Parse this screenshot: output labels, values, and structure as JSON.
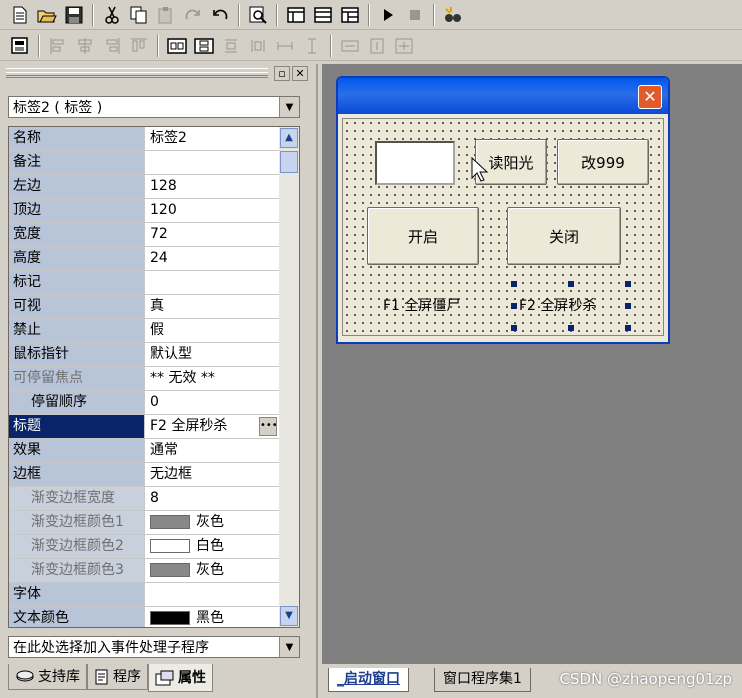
{
  "toolbar1": [
    "new-file-icon",
    "open-folder-icon",
    "save-icon",
    "cut-icon",
    "copy-icon",
    "paste-icon",
    "redo-icon",
    "undo-icon",
    "find-icon",
    "layout-a-icon",
    "layout-b-icon",
    "layout-c-icon",
    "run-icon",
    "stop-icon",
    "debug-icon"
  ],
  "toolbar2": [
    "align-grid-icon",
    "align-left-icon",
    "align-center-icon",
    "align-right-icon",
    "align-top-icon",
    "space-h-icon",
    "space-v-icon",
    "center-h-icon",
    "center-v-icon",
    "size-w-icon",
    "size-h-icon",
    "size-both-icon",
    "expand-h-icon",
    "expand-v-icon",
    "expand-both-icon"
  ],
  "object_selector": "标签2 ( 标签 )",
  "event_selector": "在此处选择加入事件处理子程序",
  "properties": [
    {
      "name": "名称",
      "value": "标签2"
    },
    {
      "name": "备注",
      "value": ""
    },
    {
      "name": "左边",
      "value": "128"
    },
    {
      "name": "顶边",
      "value": "120"
    },
    {
      "name": "宽度",
      "value": "72"
    },
    {
      "name": "高度",
      "value": "24"
    },
    {
      "name": "标记",
      "value": ""
    },
    {
      "name": "可视",
      "value": "真"
    },
    {
      "name": "禁止",
      "value": "假"
    },
    {
      "name": "鼠标指针",
      "value": "默认型"
    },
    {
      "name": "可停留焦点",
      "value": "** 无效 **"
    },
    {
      "name": "停留顺序",
      "value": "0"
    },
    {
      "name": "标题",
      "value": "F2 全屏秒杀"
    },
    {
      "name": "效果",
      "value": "通常"
    },
    {
      "name": "边框",
      "value": "无边框"
    },
    {
      "name": "渐变边框宽度",
      "value": "8"
    },
    {
      "name": "渐变边框颜色1",
      "value": "灰色",
      "swatch": "#888888"
    },
    {
      "name": "渐变边框颜色2",
      "value": "白色",
      "swatch": "#ffffff"
    },
    {
      "name": "渐变边框颜色3",
      "value": "灰色",
      "swatch": "#888888"
    },
    {
      "name": "字体",
      "value": ""
    },
    {
      "name": "文本颜色",
      "value": "黑色",
      "swatch": "#000000"
    }
  ],
  "left_tabs": [
    {
      "label": "支持库"
    },
    {
      "label": "程序"
    },
    {
      "label": "属性"
    }
  ],
  "form": {
    "btn_read": "读阳光",
    "btn_change": "改999",
    "btn_open": "开启",
    "btn_close": "关闭",
    "label1": "F1 全屏僵尸",
    "label2": "F2 全屏秒杀"
  },
  "right_tabs": [
    {
      "label": "_启动窗口"
    },
    {
      "label": "窗口程序集1"
    }
  ],
  "watermark": "CSDN @zhaopeng01zp",
  "colors": {
    "selection": "#0a246a",
    "title_bar": "#0058ee",
    "design_bg": "#808080"
  }
}
